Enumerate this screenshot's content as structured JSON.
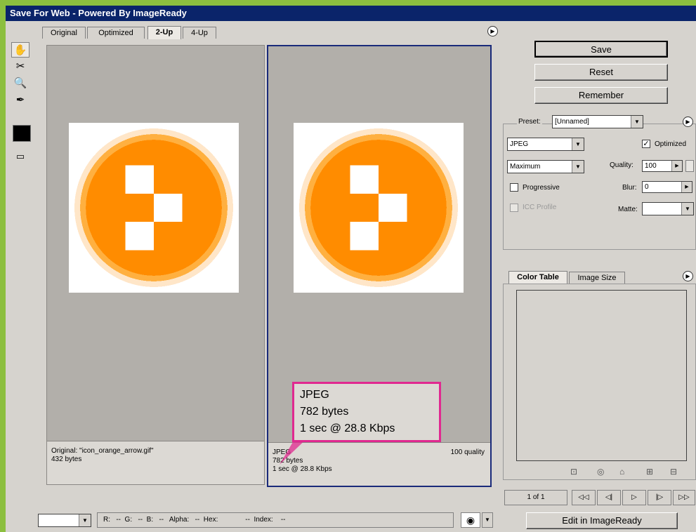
{
  "window": {
    "title": "Save For Web - Powered By ImageReady"
  },
  "tabs": [
    {
      "label": "Original",
      "active": false
    },
    {
      "label": "Optimized",
      "active": false
    },
    {
      "label": "2-Up",
      "active": true
    },
    {
      "label": "4-Up",
      "active": false
    }
  ],
  "toolbox": {
    "tools": [
      "hand-tool",
      "slice-select-tool",
      "zoom-tool",
      "eyedropper-tool"
    ],
    "color_well": "#000000"
  },
  "icon_image": {
    "orange": "#ff8c00",
    "light_orange": "#ffb040",
    "fringe": "#ffe6c8"
  },
  "panes": {
    "original": {
      "line1": "Original: \"icon_orange_arrow.gif\"",
      "line2": "432 bytes"
    },
    "optimized": {
      "format": "JPEG",
      "size": "782 bytes",
      "time": "1 sec @ 28.8 Kbps",
      "quality": "100 quality"
    }
  },
  "callout": {
    "format": "JPEG",
    "size": "782 bytes",
    "time": "1 sec @ 28.8 Kbps",
    "color": "#e02990"
  },
  "buttons": {
    "save": "Save",
    "reset": "Reset",
    "remember": "Remember",
    "edit": "Edit in ImageReady"
  },
  "settings": {
    "preset_label": "Preset:",
    "preset_value": "[Unnamed]",
    "format_value": "JPEG",
    "quality_preset_value": "Maximum",
    "optimized_label": "Optimized",
    "optimized_checked": true,
    "quality_label": "Quality:",
    "quality_value": "100",
    "progressive_label": "Progressive",
    "progressive_checked": false,
    "blur_label": "Blur:",
    "blur_value": "0",
    "icc_label": "ICC Profile",
    "matte_label": "Matte:"
  },
  "color_table": {
    "tabs": [
      {
        "label": "Color Table",
        "active": true
      },
      {
        "label": "Image Size",
        "active": false
      }
    ],
    "icons": [
      "web-shift-icon",
      "lock-icon",
      "trash-icon",
      "new-color-icon",
      "delete-color-icon"
    ]
  },
  "nav": {
    "page": "1 of 1",
    "buttons": [
      "◁◁",
      "◁|",
      "▷",
      "|▷",
      "▷▷"
    ]
  },
  "statusbar": {
    "text": "R:   --  G:   --  B:   --   Alpha:   --  Hex:              --  Index:    --"
  }
}
